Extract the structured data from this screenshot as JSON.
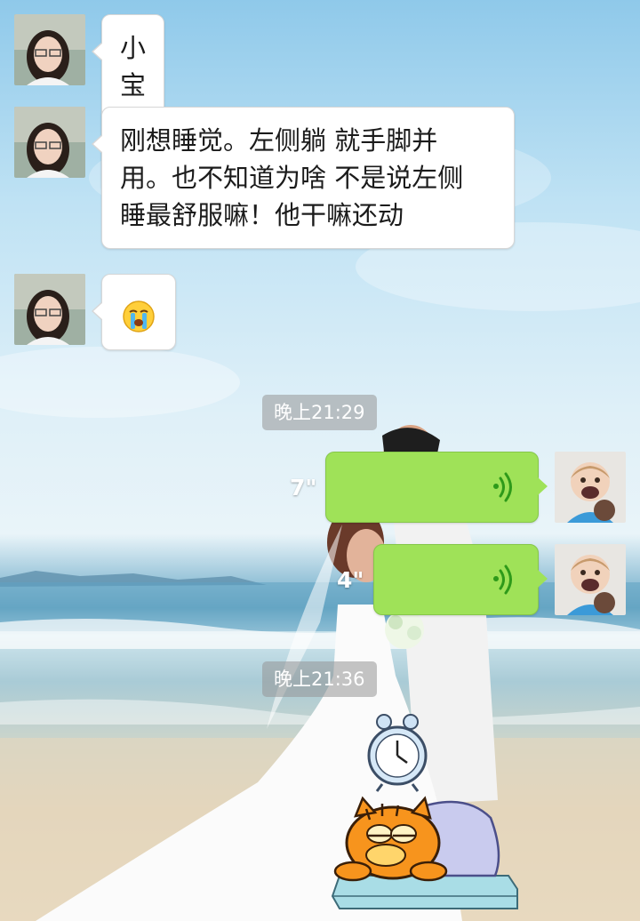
{
  "conversation": {
    "messages": [
      {
        "sender": "other",
        "type": "text",
        "text": "小宝真是"
      },
      {
        "sender": "other",
        "type": "text",
        "lines": [
          "刚想睡觉。左侧躺 就手脚并",
          "用。也不知道为啥 不是说左侧",
          "睡最舒服嘛！他干嘛还动"
        ]
      },
      {
        "sender": "other",
        "type": "emoji",
        "emoji": "crying-face"
      },
      {
        "sender": "self",
        "type": "voice",
        "duration": "7\""
      },
      {
        "sender": "self",
        "type": "voice",
        "duration": "4\""
      },
      {
        "sender": "self",
        "type": "sticker",
        "sticker": "garfield-sleeping-alarm-clock"
      }
    ],
    "timestamps": [
      "晚上21:29",
      "晚上21:36"
    ]
  },
  "colors": {
    "outgoing_bubble": "#9fe258",
    "incoming_bubble": "#ffffff",
    "voice_wave": "#2e9a1a",
    "timestamp_bg": "#969696"
  }
}
